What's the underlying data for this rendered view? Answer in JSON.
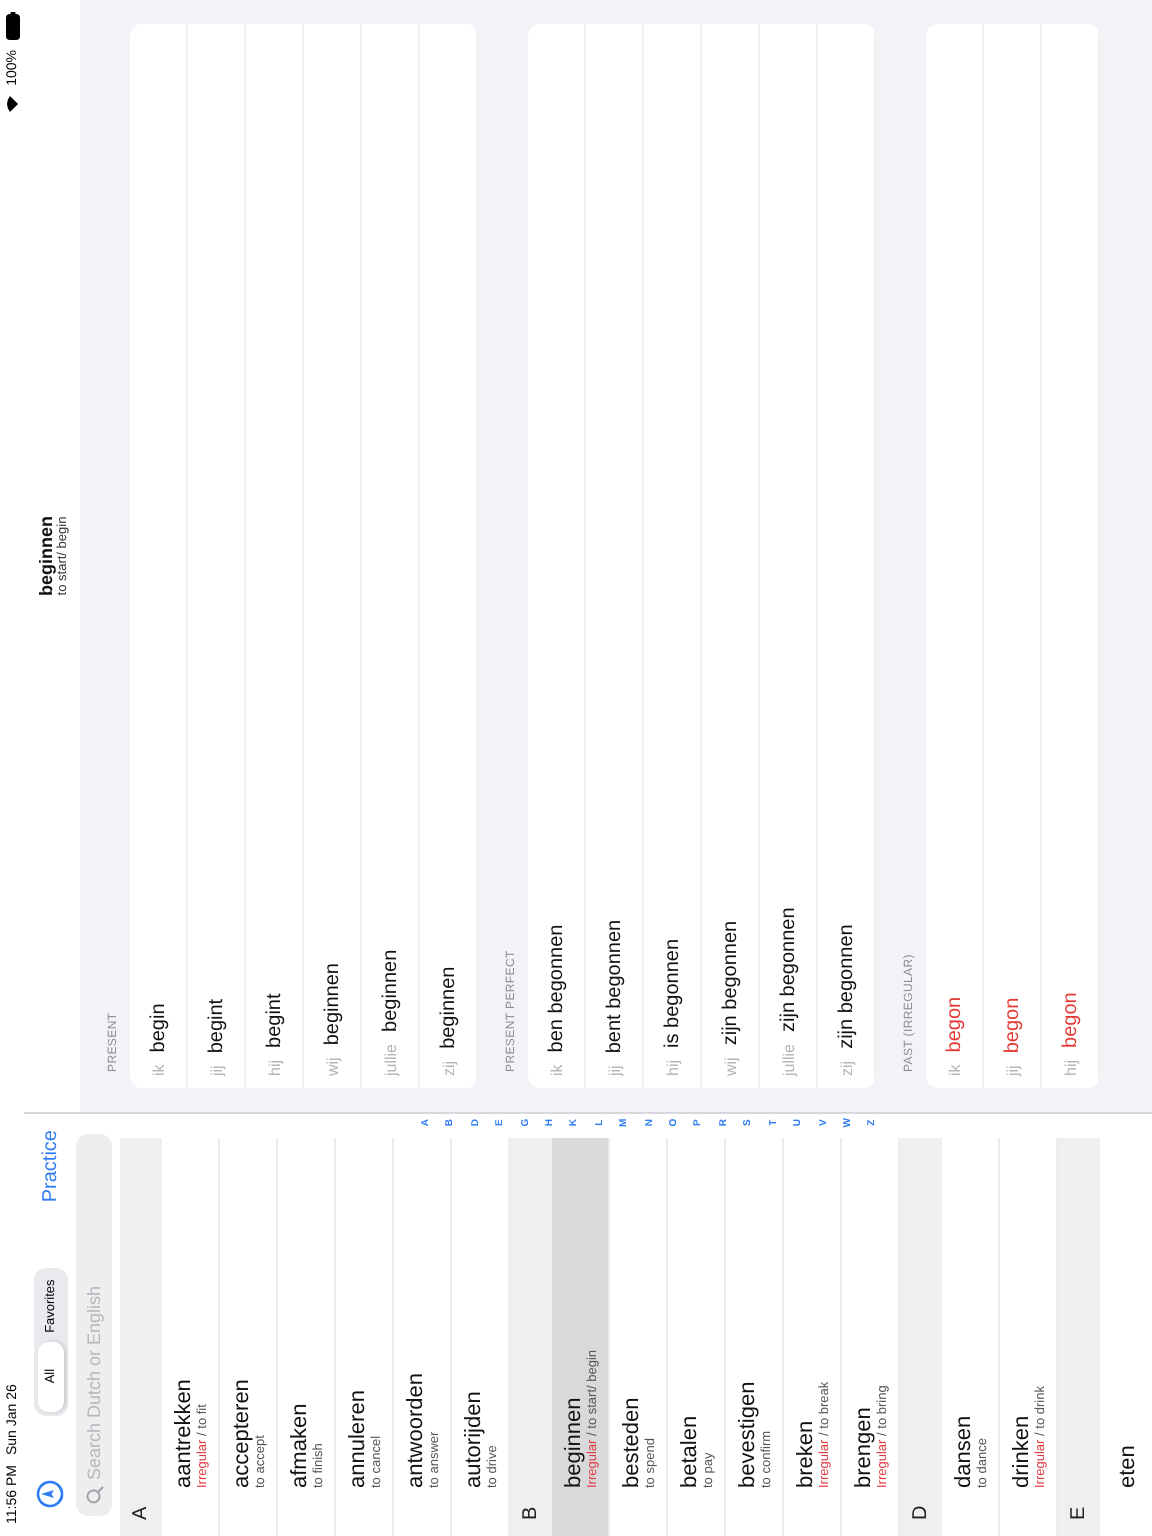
{
  "status_bar": {
    "time": "11:56 PM",
    "date": "Sun Jan 26",
    "battery": "100%"
  },
  "sidebar": {
    "segments": [
      {
        "label": "All",
        "selected": true
      },
      {
        "label": "Favorites",
        "selected": false
      }
    ],
    "practice": "Practice",
    "search": {
      "placeholder": "Search Dutch or English"
    },
    "sections": [
      {
        "letter": "A",
        "verbs": [
          {
            "name": "aantrekken",
            "tag": "Irregular",
            "meaning": "/ to fit",
            "selected": false
          },
          {
            "name": "accepteren",
            "meaning": "to accept",
            "selected": false
          },
          {
            "name": "afmaken",
            "meaning": "to finish",
            "selected": false
          },
          {
            "name": "annuleren",
            "meaning": "to cancel",
            "selected": false
          },
          {
            "name": "antwoorden",
            "meaning": "to answer",
            "selected": false
          },
          {
            "name": "autorijden",
            "meaning": "to drive",
            "selected": false
          }
        ]
      },
      {
        "letter": "B",
        "verbs": [
          {
            "name": "beginnen",
            "tag": "Irregular",
            "meaning": "/ to start/ begin",
            "selected": true
          },
          {
            "name": "besteden",
            "meaning": "to spend",
            "selected": false
          },
          {
            "name": "betalen",
            "meaning": "to pay",
            "selected": false
          },
          {
            "name": "bevestigen",
            "meaning": "to confirm",
            "selected": false
          },
          {
            "name": "breken",
            "tag": "Irregular",
            "meaning": "/ to break",
            "selected": false
          },
          {
            "name": "brengen",
            "tag": "Irregular",
            "meaning": "/ to bring",
            "selected": false
          }
        ]
      },
      {
        "letter": "D",
        "verbs": [
          {
            "name": "dansen",
            "meaning": "to dance",
            "selected": false
          },
          {
            "name": "drinken",
            "tag": "Irregular",
            "meaning": "/ to drink",
            "selected": false
          }
        ]
      },
      {
        "letter": "E",
        "verbs": [
          {
            "name": "eten",
            "selected": false
          }
        ]
      }
    ],
    "index": [
      "A",
      "B",
      "D",
      "E",
      "G",
      "H",
      "K",
      "L",
      "M",
      "N",
      "O",
      "P",
      "R",
      "S",
      "T",
      "U",
      "V",
      "W",
      "Z"
    ]
  },
  "detail": {
    "title": "beginnen",
    "subtitle": "to start/ begin",
    "tenses": [
      {
        "label": "PRESENT",
        "irregular": false,
        "rows": [
          {
            "pronoun": "ik",
            "form": "begin"
          },
          {
            "pronoun": "jij",
            "form": "begint"
          },
          {
            "pronoun": "hij",
            "form": "begint"
          },
          {
            "pronoun": "wij",
            "form": "beginnen"
          },
          {
            "pronoun": "jullie",
            "form": "beginnen"
          },
          {
            "pronoun": "zij",
            "form": "beginnen"
          }
        ]
      },
      {
        "label": "PRESENT PERFECT",
        "irregular": false,
        "rows": [
          {
            "pronoun": "ik",
            "form": "ben begonnen"
          },
          {
            "pronoun": "jij",
            "form": "bent begonnen"
          },
          {
            "pronoun": "hij",
            "form": "is begonnen"
          },
          {
            "pronoun": "wij",
            "form": "zijn begonnen"
          },
          {
            "pronoun": "jullie",
            "form": "zijn begonnen"
          },
          {
            "pronoun": "zij",
            "form": "zijn begonnen"
          }
        ]
      },
      {
        "label": "PAST (IRREGULAR)",
        "irregular": true,
        "rows": [
          {
            "pronoun": "ik",
            "form": "begon"
          },
          {
            "pronoun": "jij",
            "form": "begon"
          },
          {
            "pronoun": "hij",
            "form": "begon"
          }
        ]
      }
    ]
  }
}
